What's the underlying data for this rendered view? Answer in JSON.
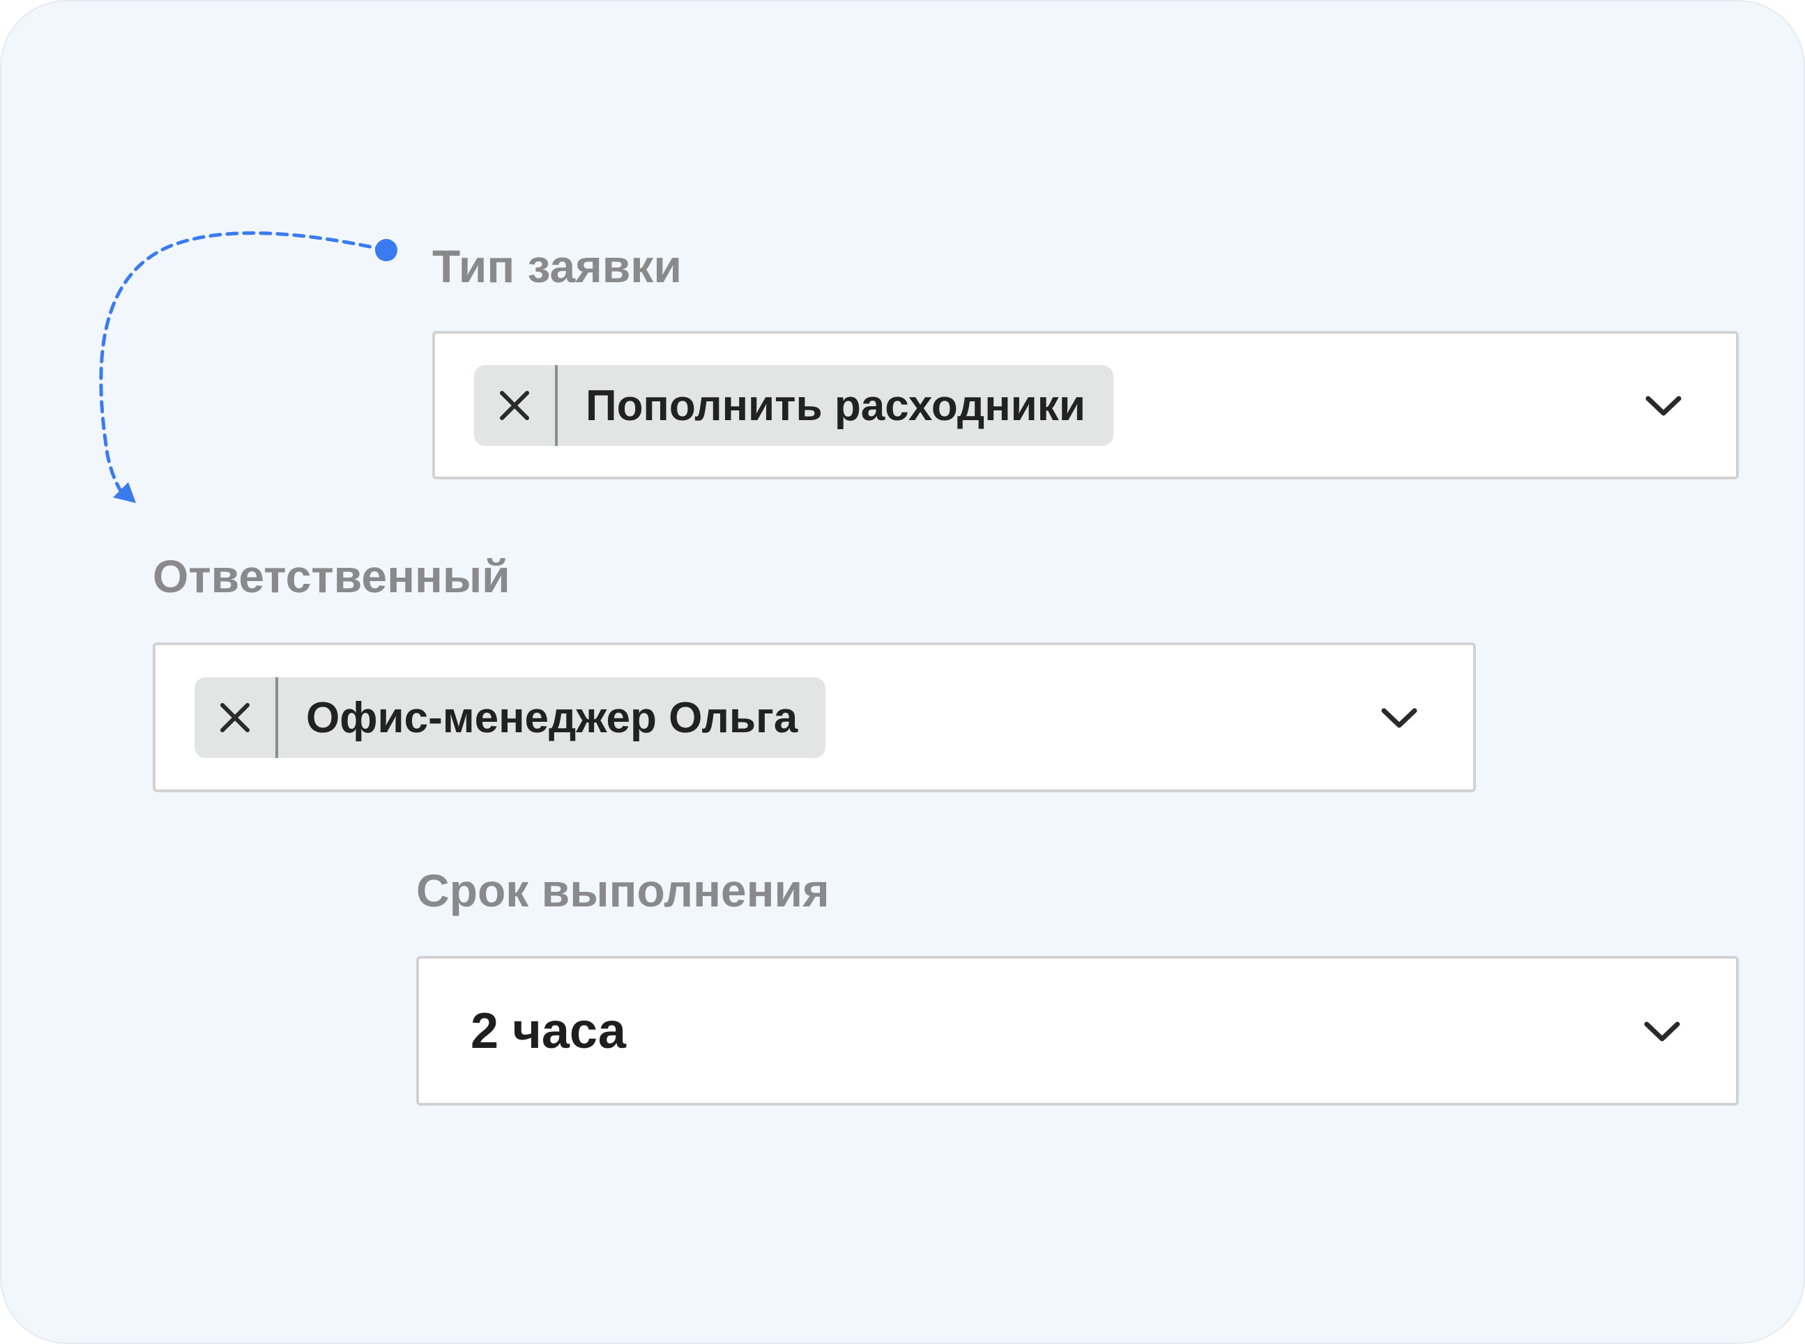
{
  "form": {
    "request_type": {
      "label": "Тип заявки",
      "selected_chip": "Пополнить расходники"
    },
    "assignee": {
      "label": "Ответственный",
      "selected_chip": "Офис-менеджер Ольга"
    },
    "deadline": {
      "label": "Срок выполнения",
      "value": "2 часа"
    }
  },
  "icons": {
    "chip_remove": "close-icon",
    "dropdown": "chevron-down-icon"
  },
  "colors": {
    "background": "#f2f7fe",
    "connector": "#3a7bf0",
    "label": "#8a8a8c",
    "chip": "#e3e4e4",
    "field_border": "#d2d2d4",
    "text": "#222222"
  }
}
